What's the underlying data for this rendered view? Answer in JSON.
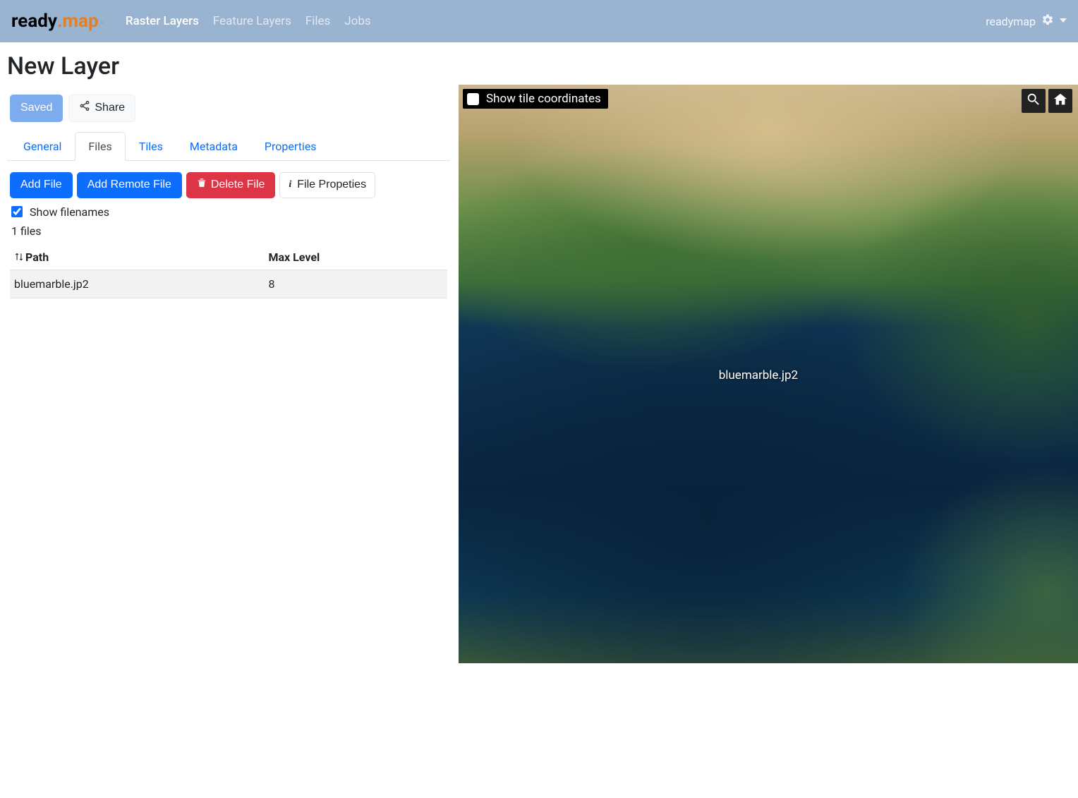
{
  "brand": {
    "ready": "ready",
    "dot": ".",
    "map": "map",
    "tm": "™"
  },
  "nav": {
    "items": [
      {
        "label": "Raster Layers",
        "active": true
      },
      {
        "label": "Feature Layers",
        "active": false
      },
      {
        "label": "Files",
        "active": false
      },
      {
        "label": "Jobs",
        "active": false
      }
    ],
    "user": "readymap"
  },
  "page": {
    "title": "New Layer"
  },
  "actions": {
    "saved": "Saved",
    "share": "Share"
  },
  "tabs": [
    {
      "id": "general",
      "label": "General",
      "active": false
    },
    {
      "id": "files",
      "label": "Files",
      "active": true
    },
    {
      "id": "tiles",
      "label": "Tiles",
      "active": false
    },
    {
      "id": "metadata",
      "label": "Metadata",
      "active": false
    },
    {
      "id": "properties",
      "label": "Properties",
      "active": false
    }
  ],
  "files_panel": {
    "buttons": {
      "add_file": "Add File",
      "add_remote": "Add Remote File",
      "delete_file": "Delete File",
      "file_props": "File Propeties"
    },
    "show_filenames_label": "Show filenames",
    "show_filenames_checked": true,
    "count_text": "1 files",
    "columns": {
      "path": "Path",
      "max_level": "Max Level"
    },
    "rows": [
      {
        "path": "bluemarble.jp2",
        "max_level": "8"
      }
    ]
  },
  "map": {
    "show_tile_coords_label": "Show tile coordinates",
    "overlay_filename": "bluemarble.jp2"
  }
}
